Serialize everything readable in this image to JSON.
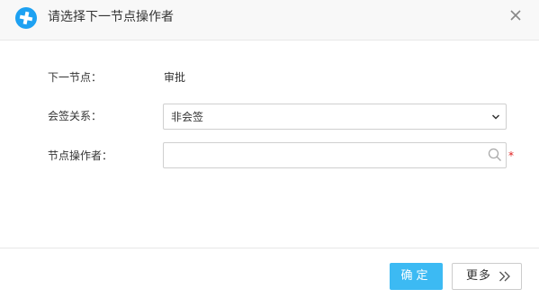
{
  "dialog": {
    "title": "请选择下一节点操作者",
    "logo_icon": "plus-cross-logo-icon",
    "close_icon": "close-icon"
  },
  "form": {
    "next_node_label": "下一节点：",
    "next_node_value": "审批",
    "countersign_label": "会签关系：",
    "countersign_value": "非会签",
    "operator_label": "节点操作者：",
    "operator_value": "",
    "operator_placeholder": "",
    "required_mark": "*"
  },
  "footer": {
    "ok_label": "确定",
    "more_label": "更多",
    "more_icon": "double-chevron-right-icon"
  },
  "colors": {
    "accent": "#3cbaf3",
    "logo": "#1da1f2",
    "required": "#e02020"
  }
}
